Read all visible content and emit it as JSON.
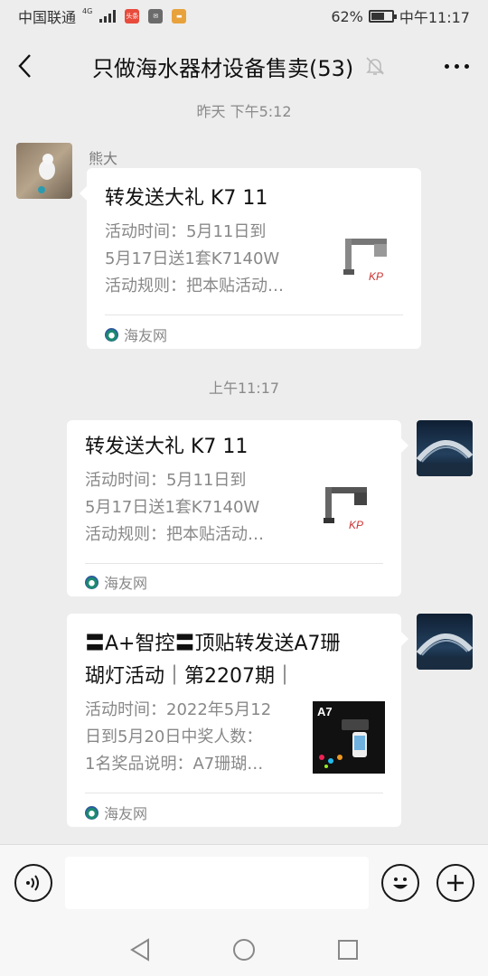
{
  "status_bar": {
    "carrier": "中国联通",
    "network": "4G",
    "app_icon_1_label": "头条",
    "battery": "62%",
    "battery_level": 0.62,
    "time": "中午11:17"
  },
  "header": {
    "title": "只做海水器材设备售卖(53)"
  },
  "messages": [
    {
      "timestamp": "昨天 下午5:12",
      "sender_name": "熊大",
      "side": "left",
      "title": "转发送大礼 K7 11",
      "desc_lines": [
        "活动时间：5月11日到",
        "5月17日送1套K7140W",
        "活动规则：把本贴活动…"
      ],
      "source": "海友网"
    },
    {
      "timestamp": "上午11:17",
      "side": "right",
      "title": "转发送大礼 K7 11",
      "desc_lines": [
        "活动时间：5月11日到",
        "5月17日送1套K7140W",
        "活动规则：把本贴活动…"
      ],
      "source": "海友网"
    },
    {
      "side": "right",
      "title_lines": [
        "〓A+智控〓顶贴转发送A7珊",
        "瑚灯活动｜第2207期｜"
      ],
      "desc_lines": [
        "活动时间：2022年5月12",
        "日到5月20日中奖人数：",
        "1名奖品说明：A7珊瑚…"
      ],
      "thumb_label": "A7",
      "source": "海友网"
    }
  ],
  "input_bar": {
    "placeholder": ""
  },
  "colors": {
    "background": "#ededed",
    "bubble": "#ffffff",
    "muted_text": "#888888"
  }
}
